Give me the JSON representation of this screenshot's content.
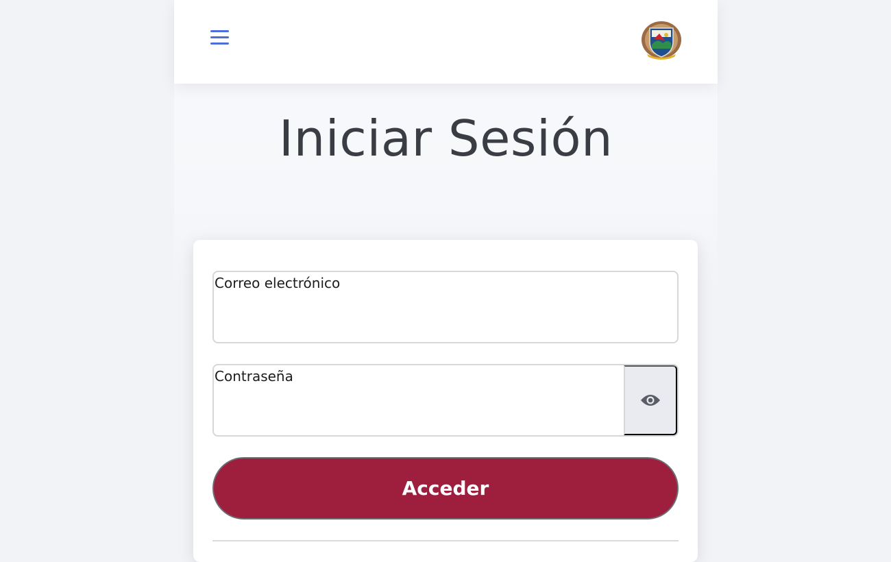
{
  "header": {
    "menu_icon": "hamburger-menu-icon",
    "logo_icon": "municipal-crest-logo"
  },
  "page": {
    "title": "Iniciar Sesión"
  },
  "form": {
    "email": {
      "label": "Correo electrónico",
      "value": ""
    },
    "password": {
      "label": "Contraseña",
      "value": "",
      "toggle_icon": "eye-icon"
    },
    "submit_label": "Acceder"
  },
  "colors": {
    "accent": "#4a6fd9",
    "primary_button": "#9e1f3d",
    "background": "#f2f3f7",
    "title_text": "#3b3d45"
  }
}
